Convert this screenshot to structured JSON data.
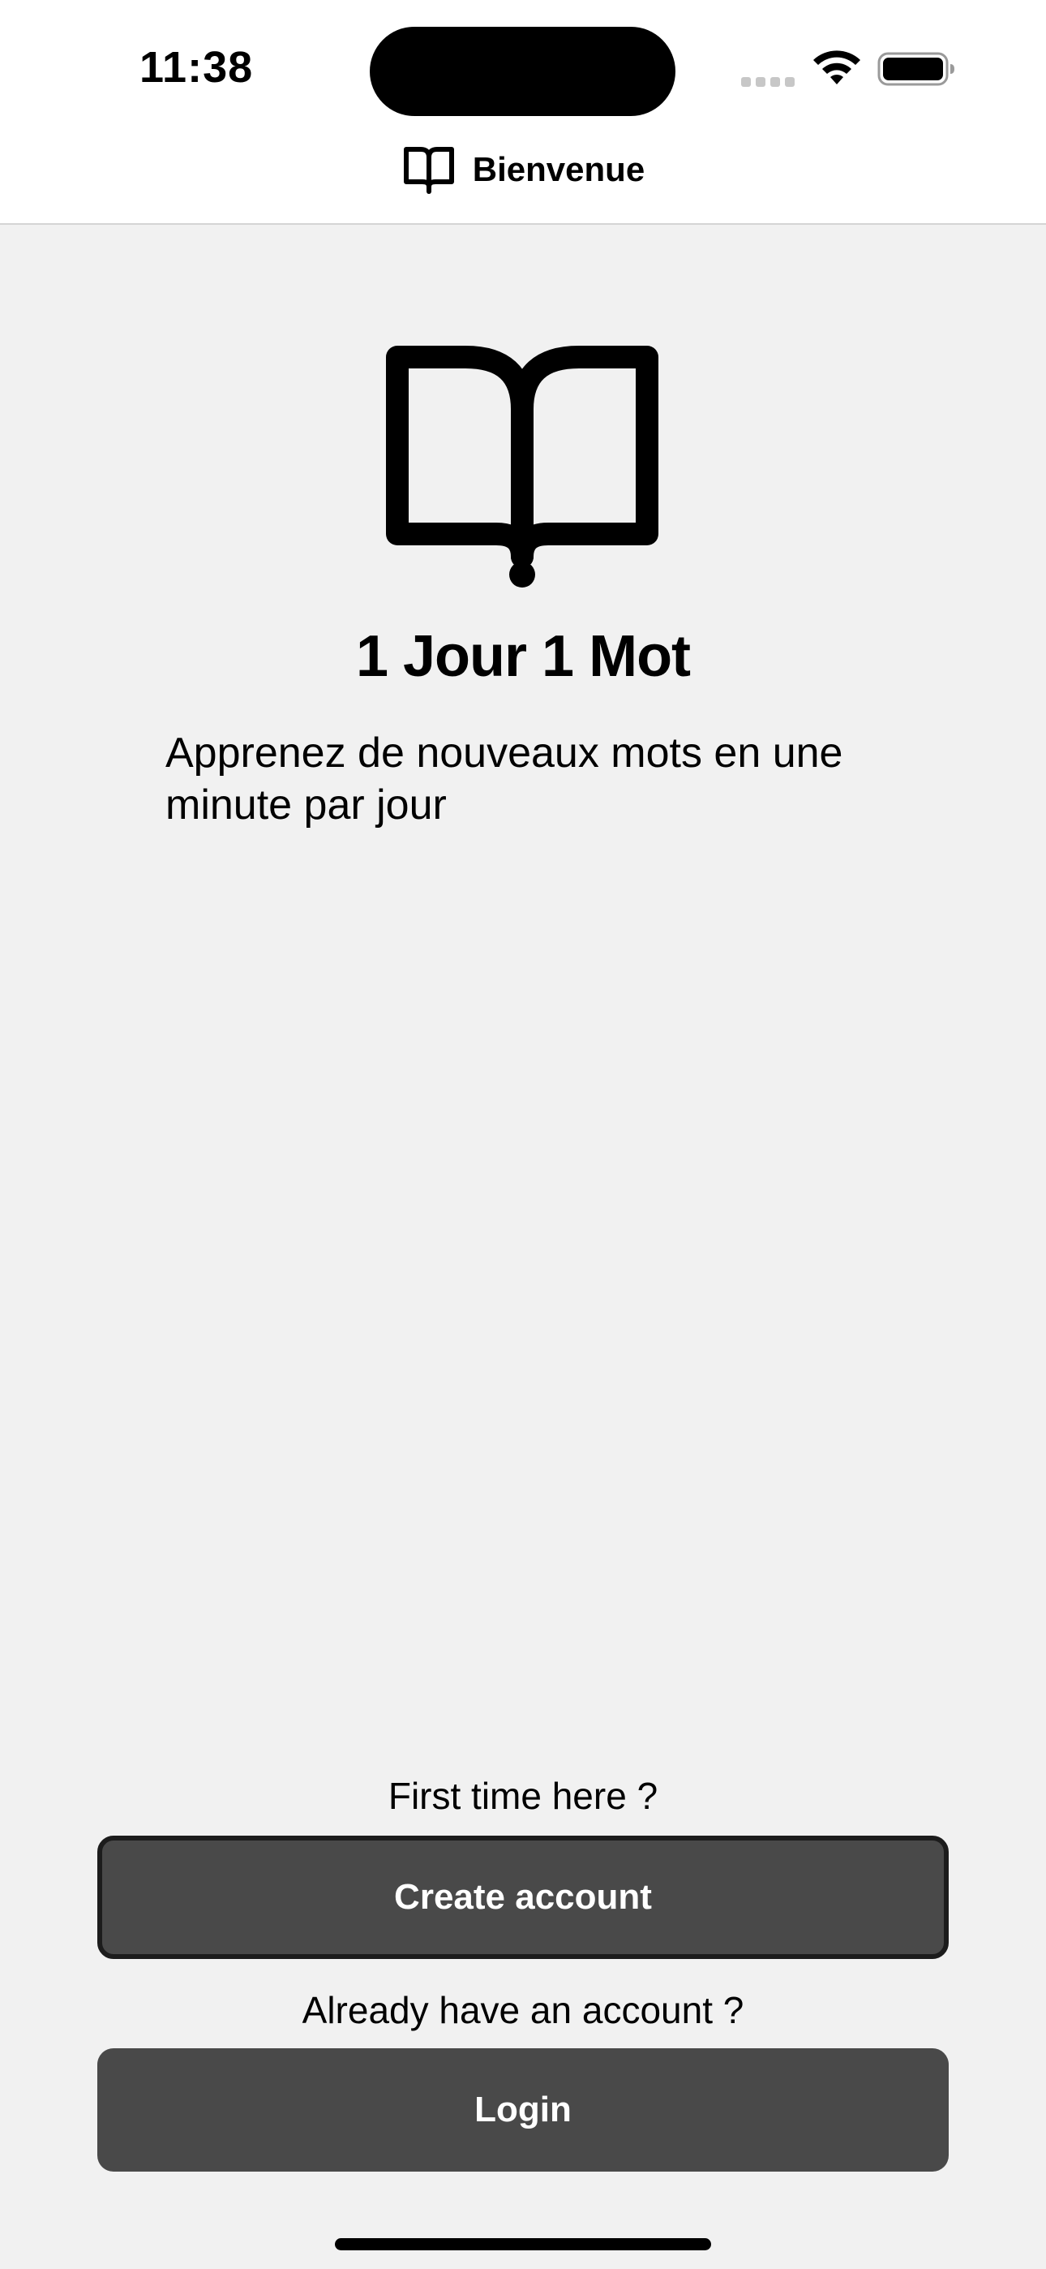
{
  "status_bar": {
    "time": "11:38",
    "icons": [
      "signal-icon",
      "wifi-icon",
      "battery-icon"
    ]
  },
  "nav": {
    "title": "Bienvenue",
    "icon": "book-icon"
  },
  "hero": {
    "icon": "book-icon",
    "title": "1 Jour 1 Mot",
    "tagline": "Apprenez de nouveaux mots en une minute par jour"
  },
  "actions": {
    "first_time_prompt": "First time here ?",
    "create_account_label": "Create account",
    "already_prompt": "Already have an account ?",
    "login_label": "Login"
  },
  "colors": {
    "background": "#f1f1f1",
    "button": "#494949",
    "button_text": "#ffffff"
  }
}
